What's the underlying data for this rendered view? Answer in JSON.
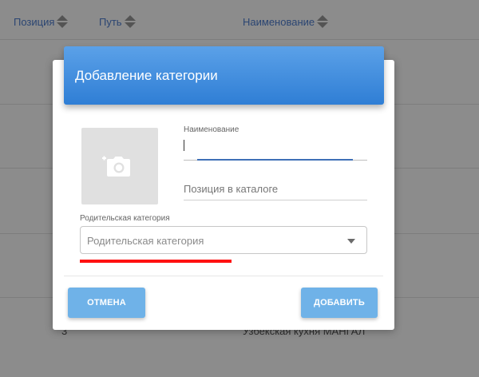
{
  "table": {
    "columns": [
      {
        "label": "Позиция"
      },
      {
        "label": "Путь"
      },
      {
        "label": "Наименование"
      }
    ],
    "visible_row": {
      "position": "3",
      "name": "Узбекская кухня МАНГАЛ"
    }
  },
  "modal": {
    "title": "Добавление категории",
    "photo": {
      "icon": "add-photo-icon"
    },
    "name_field": {
      "label": "Наименование",
      "value": ""
    },
    "position_field": {
      "placeholder": "Позиция в каталоге"
    },
    "parent_field": {
      "label": "Родительская категория",
      "placeholder": "Родительская категория"
    },
    "cancel_label": "ОТМЕНА",
    "add_label": "ДОБАВИТЬ"
  },
  "colors": {
    "header_gradient_top": "#5ba1e8",
    "header_gradient_bottom": "#2f7ed5",
    "button": "#6fb2e8",
    "annotation_underline": "#ff1111",
    "link_text": "#4f7fd0"
  }
}
